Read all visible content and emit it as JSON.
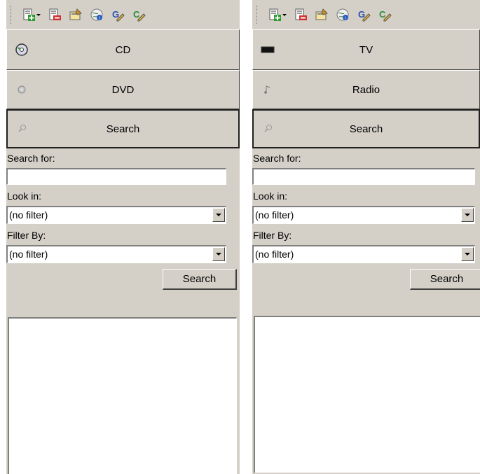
{
  "left": {
    "nav": [
      {
        "label": "CD",
        "icon": "cd-icon"
      },
      {
        "label": "DVD",
        "icon": "dvd-icon"
      },
      {
        "label": "Search",
        "icon": "search-icon"
      }
    ],
    "search_for_label": "Search for:",
    "search_for_value": "",
    "look_in_label": "Look in:",
    "look_in_value": "(no filter)",
    "filter_by_label": "Filter By:",
    "filter_by_value": "(no filter)",
    "search_button": "Search"
  },
  "right": {
    "nav": [
      {
        "label": "TV",
        "icon": "tv-icon"
      },
      {
        "label": "Radio",
        "icon": "radio-icon"
      },
      {
        "label": "Search",
        "icon": "search-icon"
      }
    ],
    "search_for_label": "Search for:",
    "search_for_value": "",
    "look_in_label": "Look in:",
    "look_in_value": "(no filter)",
    "filter_by_label": "Filter By:",
    "filter_by_value": "(no filter)",
    "search_button": "Search"
  },
  "toolbar_icons": [
    "add-item-icon",
    "remove-item-icon",
    "properties-icon",
    "web-info-icon",
    "guide-edit-icon",
    "channel-edit-icon"
  ],
  "colors": {
    "panel": "#d4d0c8",
    "accent_green": "#2e9a2e",
    "accent_red": "#d03030"
  }
}
